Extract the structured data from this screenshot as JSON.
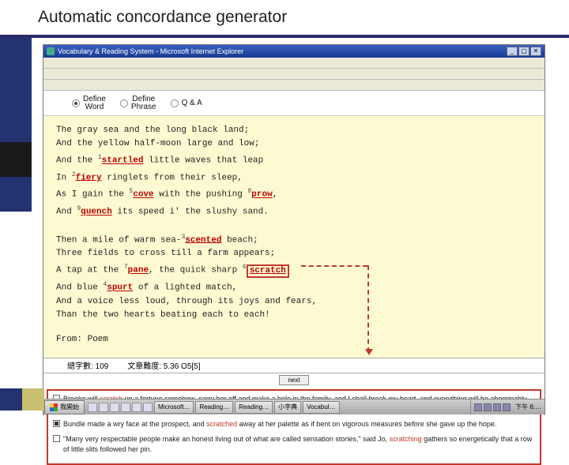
{
  "slide": {
    "title": "Automatic concordance generator"
  },
  "window": {
    "title": "Vocabulary & Reading System - Microsoft Internet Explorer",
    "win_min": "_",
    "win_max": "▢",
    "win_close": "✕"
  },
  "toolbar": {
    "define_word": "Define\nWord",
    "define_phrase": "Define\nPhrase",
    "qa": "Q & A"
  },
  "poem": {
    "l1": "The gray sea and the long black land;",
    "l2": "And the yellow half-moon large and low;",
    "l3_a": "And the ",
    "l3_w": "startled",
    "l3_b": " little waves that leap",
    "l4_a": "In ",
    "l4_w": "fiery",
    "l4_b": " ringlets from their sleep,",
    "l5_a": "As I gain the ",
    "l5_w": "cove",
    "l5_b": " with the pushing ",
    "l5_w2": "prow",
    "l5_c": ",",
    "l6_a": "And ",
    "l6_w": "quench",
    "l6_b": " its speed i' the slushy sand.",
    "l7_a": "Then a mile of warm sea-",
    "l7_w": "scented",
    "l7_b": " beach;",
    "l8": "Three fields to cross till a farm appears;",
    "l9_a": "A tap at the ",
    "l9_w": "pane",
    "l9_b": ", the quick sharp ",
    "l9_w2": "scratch",
    "l10_a": "And blue ",
    "l10_w": "spurt",
    "l10_b": " of a lighted match,",
    "l11": "And a voice less loud, through its joys and fears,",
    "l12": "Than the two hearts beating each to each!",
    "from": "From: Poem"
  },
  "stats": {
    "wordcount_label": "總字數: 109",
    "difficulty_label": "文章難度: 5.36    O5[5]"
  },
  "controls": {
    "next": "next"
  },
  "results": {
    "r1_a": "Brooke will ",
    "r1_kw": "scratch",
    "r1_b": " up a fortune somehow, carry her off and make a hole in the family, and I shall break my heart, and everything will be abominably uncomfortable.",
    "r2_a": "Bundle made a wry face at the prospect, and ",
    "r2_kw": "scratched",
    "r2_b": " away at her palette as if bent on vigorous measures before she gave up the hope.",
    "r3_a": "\"Many very respectable people make an honest living out of what are called sensation stories,\" said Jo, ",
    "r3_kw": "scratching",
    "r3_b": " gathers so energetically that a row of little slits followed her pin."
  },
  "taskbar": {
    "start": "我開始",
    "apps": [
      "Microsoft…",
      "Reading…",
      "Reading…",
      "小字典",
      "Vocabul…"
    ],
    "clock": "下午 6:…"
  }
}
